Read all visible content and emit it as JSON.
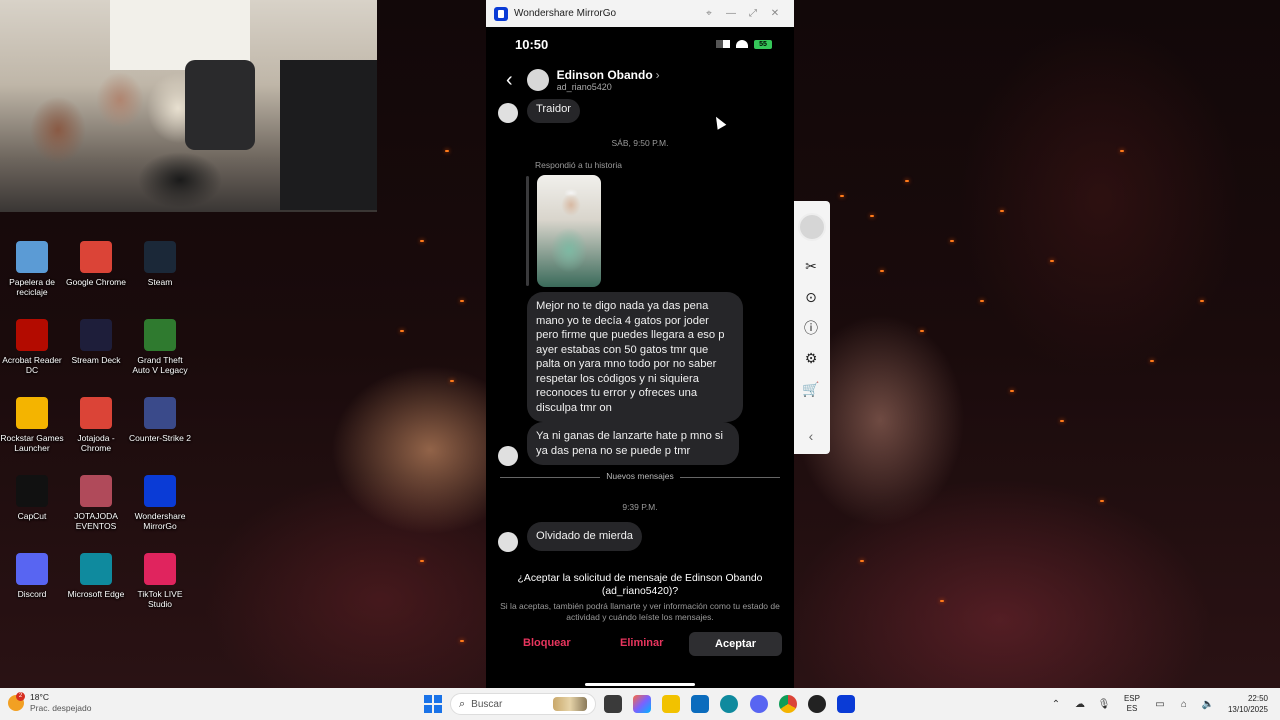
{
  "desktop": {
    "icons": [
      {
        "label": "Papelera de reciclaje",
        "icon": "recycle-bin-icon",
        "color": "#5b9bd5"
      },
      {
        "label": "Google Chrome",
        "icon": "chrome-icon",
        "color": "#db4437"
      },
      {
        "label": "Steam",
        "icon": "steam-icon",
        "color": "#1b2838"
      },
      {
        "label": "Acrobat Reader DC",
        "icon": "acrobat-icon",
        "color": "#b30b00"
      },
      {
        "label": "Stream Deck",
        "icon": "stream-deck-icon",
        "color": "#1e1e3a"
      },
      {
        "label": "Grand Theft Auto V Legacy",
        "icon": "gta-icon",
        "color": "#2f7a2f"
      },
      {
        "label": "Rockstar Games Launcher",
        "icon": "rockstar-icon",
        "color": "#f4b400"
      },
      {
        "label": "Jotajoda - Chrome",
        "icon": "chrome-icon",
        "color": "#db4437"
      },
      {
        "label": "Counter-Strike 2",
        "icon": "cs2-icon",
        "color": "#3a4a8a"
      },
      {
        "label": "CapCut",
        "icon": "capcut-icon",
        "color": "#111111"
      },
      {
        "label": "JOTAJODA EVENTOS",
        "icon": "file-icon",
        "color": "#b04a5a"
      },
      {
        "label": "Wondershare MirrorGo",
        "icon": "mirrorgo-icon",
        "color": "#0a3bd6"
      },
      {
        "label": "Discord",
        "icon": "discord-icon",
        "color": "#5865f2"
      },
      {
        "label": "Microsoft Edge",
        "icon": "edge-icon",
        "color": "#0f8a9e"
      },
      {
        "label": "TikTok LIVE Studio",
        "icon": "tiktok-icon",
        "color": "#e0245e"
      }
    ]
  },
  "window": {
    "title": "Wondershare MirrorGo",
    "controls": [
      "pin-icon",
      "minimize-icon",
      "maximize-icon",
      "close-icon"
    ]
  },
  "phone": {
    "status": {
      "time": "10:50",
      "battery": "55"
    },
    "header": {
      "name": "Edinson Obando",
      "username": "ad_riano5420"
    },
    "messages": {
      "first": "Traidor",
      "ts1": "SÁB, 9:50 P.M.",
      "story_reply": "Respondió a tu historia",
      "long": "Mejor no te digo nada ya das pena mano yo te decía 4 gatos por joder pero firme que puedes llegara a eso p ayer estabas con 50 gatos tmr que palta on yara mno todo por no saber respetar los códigos y ni siquiera reconoces tu error y ofreces una disculpa tmr on",
      "second": "Ya ni ganas de lanzarte hate p mno si ya das pena no se puede p tmr",
      "new_label": "Nuevos mensajes",
      "ts2": "9:39 P.M.",
      "last": "Olvidado de mierda"
    },
    "request": {
      "question": "¿Aceptar la solicitud de mensaje de Edinson Obando (ad_riano5420)?",
      "detail": "Si la aceptas, también podrá llamarte y ver información como tu estado de actividad y cuándo leíste los mensajes.",
      "block": "Bloquear",
      "delete": "Eliminar",
      "accept": "Aceptar"
    }
  },
  "side_toolbar": [
    "avatar",
    "scissors-icon",
    "record-icon",
    "alert-icon",
    "settings-icon",
    "cart-icon",
    "collapse-icon"
  ],
  "taskbar": {
    "weather_temp": "18°C",
    "weather_desc": "Prac. despejado",
    "weather_badge": "2",
    "search_placeholder": "Buscar",
    "lang_top": "ESP",
    "lang_bottom": "ES",
    "time": "22:50",
    "date": "13/10/2025"
  },
  "colors": {
    "danger": "#e8355e",
    "bubble": "#262629",
    "accent": "#0a3bd6"
  }
}
